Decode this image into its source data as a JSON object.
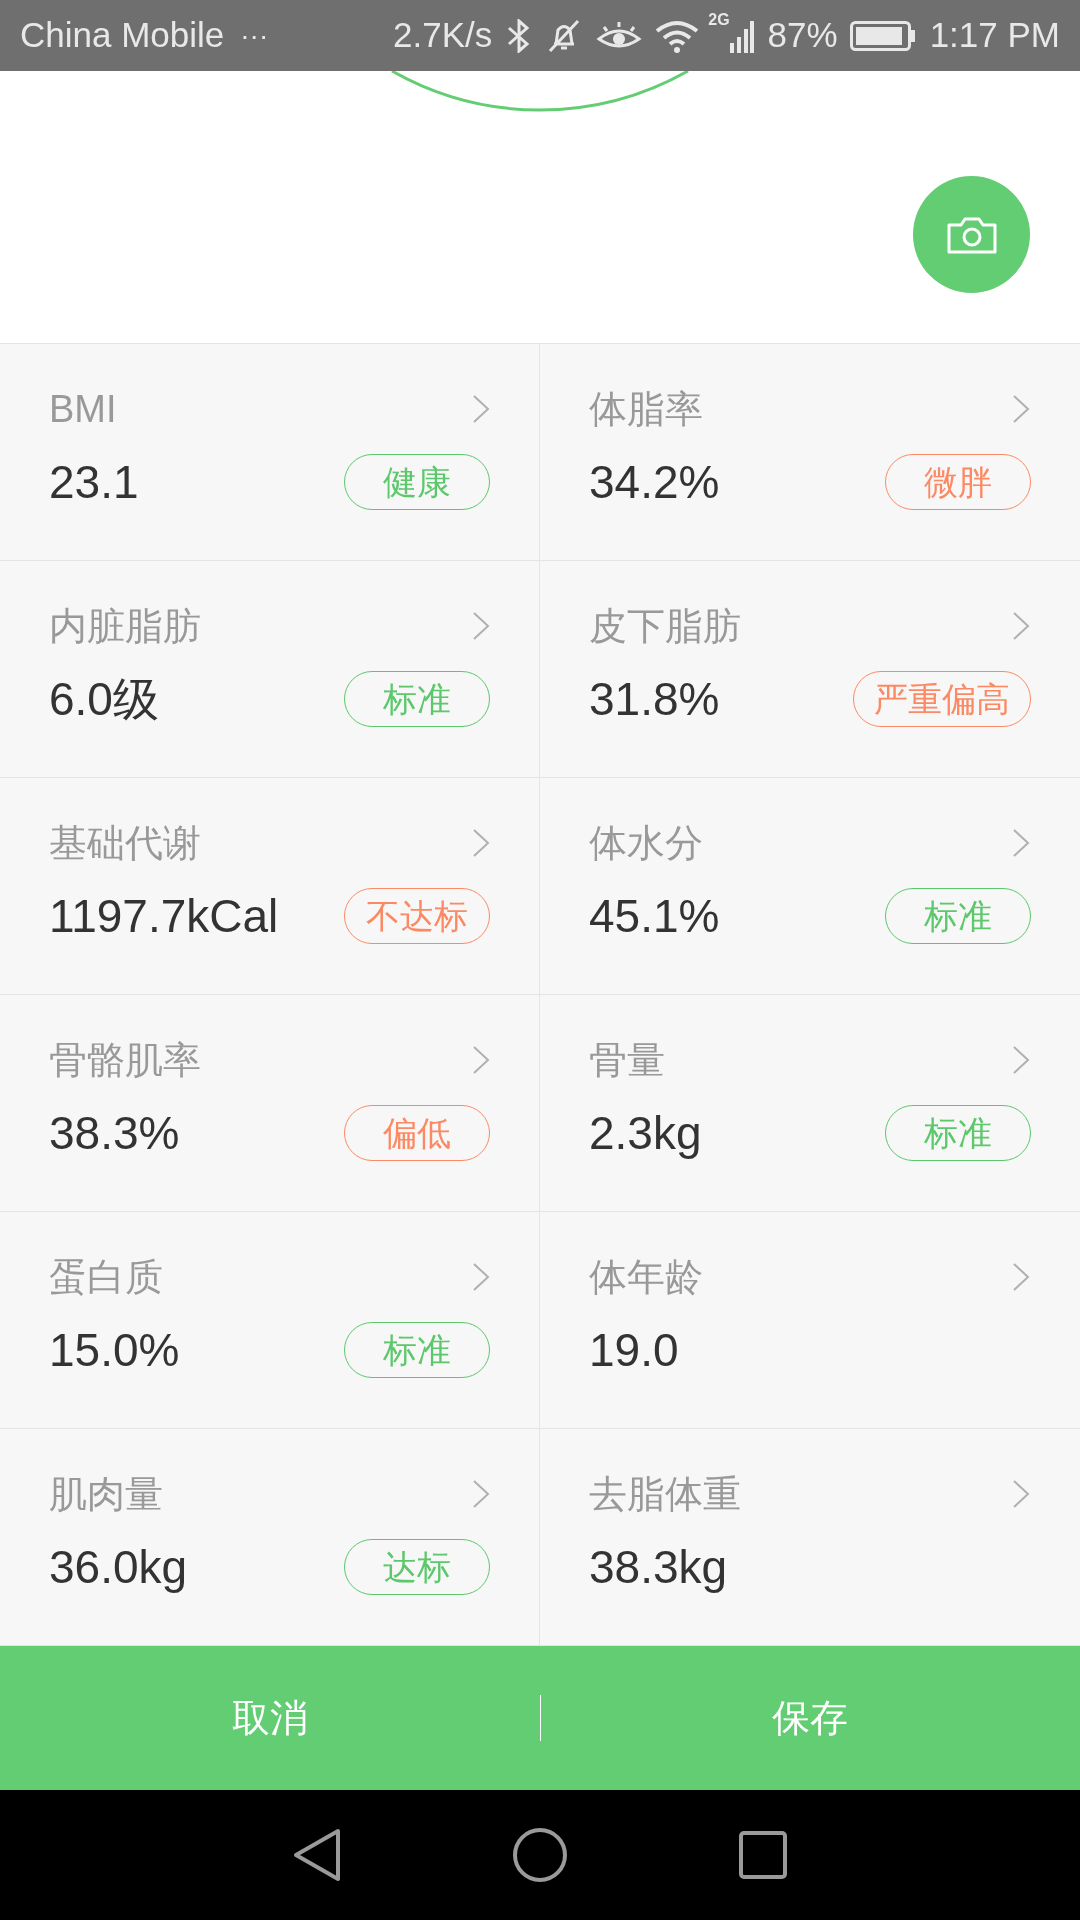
{
  "status_bar": {
    "carrier": "China Mobile",
    "more": "···",
    "speed": "2.7K/s",
    "network": "2G",
    "battery": "87%",
    "time": "1:17 PM"
  },
  "metrics": [
    {
      "label": "BMI",
      "value": "23.1",
      "badge": "健康",
      "color": "#5cc86b"
    },
    {
      "label": "体脂率",
      "value": "34.2%",
      "badge": "微胖",
      "color": "#fb8a64"
    },
    {
      "label": "内脏脂肪",
      "value": "6.0级",
      "badge": "标准",
      "color": "#5cc86b"
    },
    {
      "label": "皮下脂肪",
      "value": "31.8%",
      "badge": "严重偏高",
      "color": "#fb8a64"
    },
    {
      "label": "基础代谢",
      "value": "1197.7kCal",
      "badge": "不达标",
      "color": "#fb8a64"
    },
    {
      "label": "体水分",
      "value": "45.1%",
      "badge": "标准",
      "color": "#5cc86b"
    },
    {
      "label": "骨骼肌率",
      "value": "38.3%",
      "badge": "偏低",
      "color": "#fb8a64"
    },
    {
      "label": "骨量",
      "value": "2.3kg",
      "badge": "标准",
      "color": "#5cc86b"
    },
    {
      "label": "蛋白质",
      "value": "15.0%",
      "badge": "标准",
      "color": "#5cc86b"
    },
    {
      "label": "体年龄",
      "value": "19.0"
    },
    {
      "label": "肌肉量",
      "value": "36.0kg",
      "badge": "达标",
      "color": "#5cc86b"
    },
    {
      "label": "去脂体重",
      "value": "38.3kg"
    }
  ],
  "buttons": [
    "取消",
    "保存"
  ]
}
